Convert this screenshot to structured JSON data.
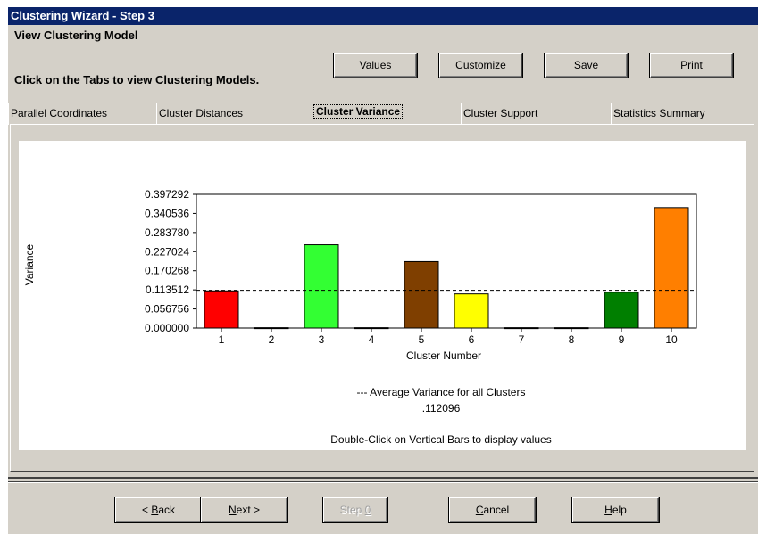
{
  "window": {
    "title": "Clustering Wizard - Step 3"
  },
  "header": {
    "subtitle": "View Clustering Model",
    "instruction": "Click on the Tabs to view Clustering Models."
  },
  "toolbar": {
    "values": {
      "label_pre": "",
      "label_ul": "V",
      "label_post": "alues"
    },
    "customize": {
      "label_pre": "C",
      "label_ul": "u",
      "label_post": "stomize"
    },
    "save": {
      "label_pre": "",
      "label_ul": "S",
      "label_post": "ave"
    },
    "print": {
      "label_pre": "",
      "label_ul": "P",
      "label_post": "rint"
    }
  },
  "tabs": [
    {
      "label": "Parallel Coordinates",
      "active": false
    },
    {
      "label": "Cluster Distances",
      "active": false
    },
    {
      "label": "Cluster Variance",
      "active": true
    },
    {
      "label": "Cluster Support",
      "active": false
    },
    {
      "label": "Statistics Summary",
      "active": false
    }
  ],
  "chart_data": {
    "type": "bar",
    "ylabel": "Variance",
    "xlabel": "Cluster Number",
    "categories": [
      "1",
      "2",
      "3",
      "4",
      "5",
      "6",
      "7",
      "8",
      "9",
      "10"
    ],
    "values": [
      0.1105,
      0.001,
      0.2475,
      0.001,
      0.1975,
      0.1015,
      0.001,
      0.001,
      0.1065,
      0.358
    ],
    "colors": [
      "#ff0000",
      "#ffffff",
      "#33ff33",
      "#ffffff",
      "#7f3f00",
      "#ffff00",
      "#ffffff",
      "#ffffff",
      "#007f00",
      "#ff7f00"
    ],
    "ylim": [
      0,
      0.397292
    ],
    "yticks": [
      "0.000000",
      "0.056756",
      "0.113512",
      "0.170268",
      "0.227024",
      "0.283780",
      "0.340536",
      "0.397292"
    ],
    "ytick_values": [
      0,
      0.056756,
      0.113512,
      0.170268,
      0.227024,
      0.28378,
      0.340536,
      0.397292
    ],
    "average_value": 0.112096,
    "average_label": "--- Average Variance for all Clusters",
    "average_text": ".112096",
    "hint": "Double-Click on Vertical Bars to display values",
    "grid": false
  },
  "footer": {
    "back": {
      "label_pre": "< ",
      "label_ul": "B",
      "label_post": "ack"
    },
    "next": {
      "label_pre": "",
      "label_ul": "N",
      "label_post": "ext >"
    },
    "step": {
      "label_pre": "Step ",
      "label_ul": "0",
      "label_post": ""
    },
    "cancel": {
      "label_pre": "",
      "label_ul": "C",
      "label_post": "ancel"
    },
    "help": {
      "label_pre": "",
      "label_ul": "H",
      "label_post": "elp"
    }
  }
}
